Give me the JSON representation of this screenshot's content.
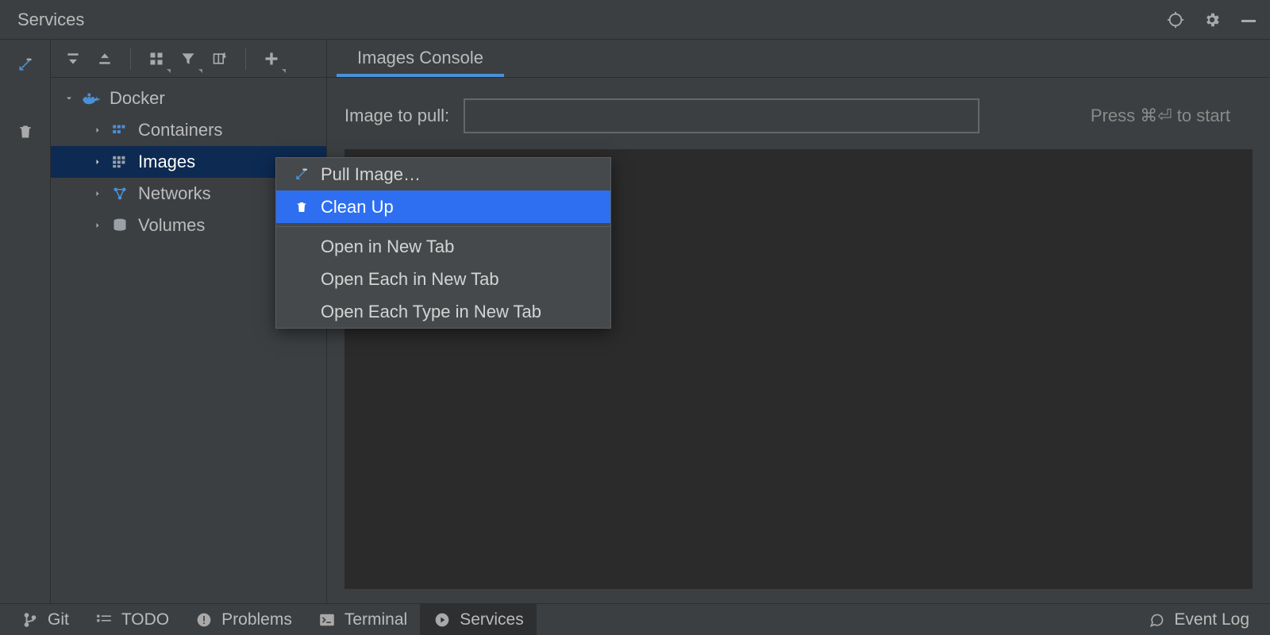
{
  "titlebar": {
    "title": "Services"
  },
  "tree": {
    "root": {
      "label": "Docker"
    },
    "children": [
      {
        "label": "Containers"
      },
      {
        "label": "Images"
      },
      {
        "label": "Networks"
      },
      {
        "label": "Volumes"
      }
    ]
  },
  "content": {
    "tab_label": "Images Console",
    "pull_label": "Image to pull:",
    "pull_value": "",
    "hint": "Press ⌘⏎ to start"
  },
  "context_menu": {
    "items": [
      {
        "label": "Pull Image…"
      },
      {
        "label": "Clean Up"
      },
      {
        "label": "Open in New Tab"
      },
      {
        "label": "Open Each in New Tab"
      },
      {
        "label": "Open Each Type in New Tab"
      }
    ]
  },
  "statusbar": {
    "git": "Git",
    "todo": "TODO",
    "problems": "Problems",
    "terminal": "Terminal",
    "services": "Services",
    "eventlog": "Event Log"
  }
}
